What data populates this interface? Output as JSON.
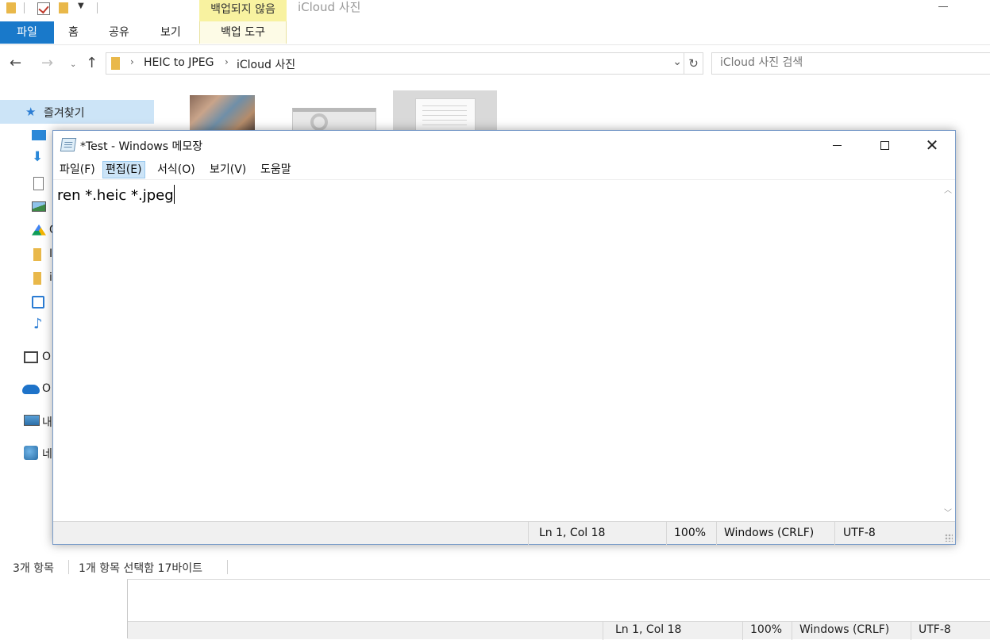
{
  "explorer": {
    "title": "iCloud 사진",
    "context_tab_header": "백업되지 않음",
    "ribbon_tabs": {
      "file": "파일",
      "home": "홈",
      "share": "공유",
      "view": "보기",
      "backup_tools": "백업 도구"
    },
    "breadcrumb": [
      "HEIC to JPEG",
      "iCloud 사진"
    ],
    "search_placeholder": "iCloud 사진 검색",
    "nav": {
      "favorites_label": "즐겨찾기",
      "items": [
        {
          "icon": "desktop-icon",
          "label": ""
        },
        {
          "icon": "download-icon",
          "label": ""
        },
        {
          "icon": "document-icon",
          "label": ""
        },
        {
          "icon": "pictures-icon",
          "label": ""
        },
        {
          "icon": "google-drive-icon",
          "label": "G"
        },
        {
          "icon": "folder-icon",
          "label": "I"
        },
        {
          "icon": "folder-icon",
          "label": "i"
        },
        {
          "icon": "photos-icon",
          "label": ""
        },
        {
          "icon": "music-icon",
          "label": ""
        }
      ],
      "sections": [
        {
          "icon": "office-icon",
          "label": "O"
        },
        {
          "icon": "onedrive-icon",
          "label": "O"
        },
        {
          "icon": "this-pc-icon",
          "label": "내"
        },
        {
          "icon": "network-icon",
          "label": "네"
        }
      ]
    },
    "status": {
      "item_count": "3개 항목",
      "selection": "1개 항목 선택함 17바이트"
    }
  },
  "bg_notepad": {
    "status": {
      "position": "Ln 1, Col 18",
      "zoom": "100%",
      "line_ending": "Windows (CRLF)",
      "encoding": "UTF-8"
    }
  },
  "notepad": {
    "title": "*Test - Windows 메모장",
    "menu": [
      "파일(F)",
      "편집(E)",
      "서식(O)",
      "보기(V)",
      "도움말"
    ],
    "active_menu_index": 1,
    "content": "ren *.heic *.jpeg",
    "status": {
      "position": "Ln 1, Col 18",
      "zoom": "100%",
      "line_ending": "Windows (CRLF)",
      "encoding": "UTF-8"
    }
  },
  "colors": {
    "ribbon_file_tab": "#1979ca",
    "context_tab": "#f8f2a0",
    "selection": "#cce4f7",
    "folder": "#e9b84a"
  }
}
